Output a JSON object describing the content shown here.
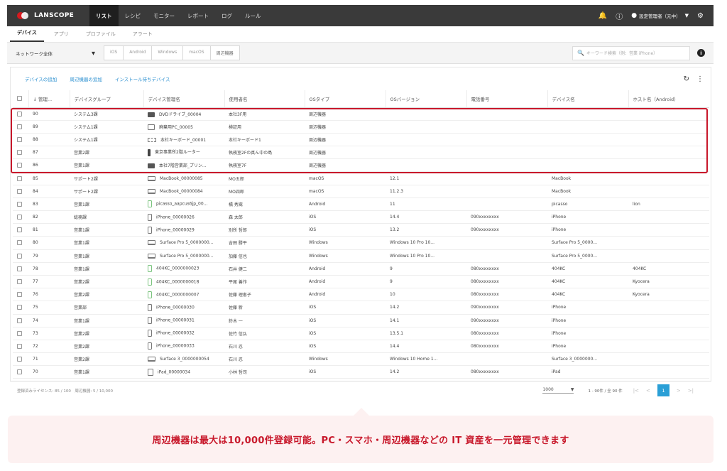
{
  "app": {
    "logo": "LANSCOPE"
  },
  "nav": [
    "リスト",
    "レシピ",
    "モニター",
    "レポート",
    "ログ",
    "ルール"
  ],
  "header": {
    "user": "設定管理者（元中）"
  },
  "subtabs": [
    "デバイス",
    "アプリ",
    "プロファイル",
    "アラート"
  ],
  "filters": {
    "scope": "ネットワーク全体",
    "os_tabs": [
      "iOS",
      "Android",
      "Windows",
      "macOS",
      "周辺機器"
    ],
    "search_placeholder": "キーワード検索（例：営業 iPhone）"
  },
  "actions": [
    "デバイスの追加",
    "周辺機器の追加",
    "インストール待ちデバイス"
  ],
  "columns": [
    "管理...",
    "デバイスグループ",
    "デバイス管理名",
    "使用者名",
    "OSタイプ",
    "OSバージョン",
    "電話番号",
    "デバイス名",
    "ホスト名（Android）"
  ],
  "rows": [
    {
      "id": "90",
      "group": "システム3課",
      "icon": "printer",
      "name": "DVDドライブ_00004",
      "user": "本社3F用",
      "os": "周辺機器",
      "ver": "",
      "phone": "",
      "device": "",
      "host": ""
    },
    {
      "id": "89",
      "group": "システム1課",
      "icon": "pc",
      "name": "廃棄用PC_00005",
      "user": "検証用",
      "os": "周辺機器",
      "ver": "",
      "phone": "",
      "device": "",
      "host": ""
    },
    {
      "id": "88",
      "group": "システム1課",
      "icon": "keyboard",
      "name": "本社キーボード_00001",
      "user": "本社キーボード1",
      "os": "周辺機器",
      "ver": "",
      "phone": "",
      "device": "",
      "host": ""
    },
    {
      "id": "87",
      "group": "営業2課",
      "icon": "router",
      "name": "東京事業所2階ルーター",
      "user": "執務室2Fの真ん中の島",
      "os": "周辺機器",
      "ver": "",
      "phone": "",
      "device": "",
      "host": ""
    },
    {
      "id": "86",
      "group": "営業1課",
      "icon": "printer",
      "name": "本社7階営業部_プリン...",
      "user": "執務室7F",
      "os": "周辺機器",
      "ver": "",
      "phone": "",
      "device": "",
      "host": ""
    },
    {
      "id": "85",
      "group": "サポート2課",
      "icon": "laptop",
      "name": "MacBook_00000085",
      "user": "MO五郎",
      "os": "macOS",
      "ver": "12.1",
      "phone": "",
      "device": "MacBook",
      "host": ""
    },
    {
      "id": "84",
      "group": "サポート2課",
      "icon": "laptop",
      "name": "MacBook_00000084",
      "user": "MO四郎",
      "os": "macOS",
      "ver": "11.2.3",
      "phone": "",
      "device": "MacBook",
      "host": ""
    },
    {
      "id": "83",
      "group": "営業1課",
      "icon": "android",
      "name": "picasso_aapcus6jp_00...",
      "user": "橘 秀嵩",
      "os": "Android",
      "ver": "11",
      "phone": "",
      "device": "picasso",
      "host": "lion"
    },
    {
      "id": "82",
      "group": "総務課",
      "icon": "phone",
      "name": "iPhone_00000026",
      "user": "森 太郎",
      "os": "iOS",
      "ver": "14.4",
      "phone": "090xxxxxxxx",
      "device": "iPhone",
      "host": ""
    },
    {
      "id": "81",
      "group": "営業1課",
      "icon": "phone",
      "name": "iPhone_00000029",
      "user": "別所 哲郎",
      "os": "iOS",
      "ver": "13.2",
      "phone": "090xxxxxxxx",
      "device": "iPhone",
      "host": ""
    },
    {
      "id": "80",
      "group": "営業1課",
      "icon": "laptop",
      "name": "Surface Pro 5_0000000...",
      "user": "吉田 勝平",
      "os": "Windows",
      "ver": "Windows 10 Pro 10...",
      "phone": "",
      "device": "Surface Pro 5_0000...",
      "host": ""
    },
    {
      "id": "79",
      "group": "営業1課",
      "icon": "laptop",
      "name": "Surface Pro 5_0000000...",
      "user": "加藤 信也",
      "os": "Windows",
      "ver": "Windows 10 Pro 10...",
      "phone": "",
      "device": "Surface Pro 5_0000...",
      "host": ""
    },
    {
      "id": "78",
      "group": "営業1課",
      "icon": "android",
      "name": "404KC_0000000023",
      "user": "石井 健二",
      "os": "Android",
      "ver": "9",
      "phone": "080xxxxxxxx",
      "device": "404KC",
      "host": "404KC"
    },
    {
      "id": "77",
      "group": "営業2課",
      "icon": "android",
      "name": "404KC_0000000018",
      "user": "平尾 善作",
      "os": "Android",
      "ver": "9",
      "phone": "080xxxxxxxx",
      "device": "404KC",
      "host": "Kyocera"
    },
    {
      "id": "76",
      "group": "営業2課",
      "icon": "android",
      "name": "404KC_0000000007",
      "user": "佐藤 理恵子",
      "os": "Android",
      "ver": "10",
      "phone": "080xxxxxxxx",
      "device": "404KC",
      "host": "Kyocera"
    },
    {
      "id": "75",
      "group": "営業部",
      "icon": "phone",
      "name": "iPhone_00000030",
      "user": "佐藤 新",
      "os": "iOS",
      "ver": "14.2",
      "phone": "090xxxxxxxx",
      "device": "iPhone",
      "host": ""
    },
    {
      "id": "74",
      "group": "営業1課",
      "icon": "phone",
      "name": "iPhone_00000031",
      "user": "鈴木 一",
      "os": "iOS",
      "ver": "14.1",
      "phone": "090xxxxxxxx",
      "device": "iPhone",
      "host": ""
    },
    {
      "id": "73",
      "group": "営業2課",
      "icon": "phone",
      "name": "iPhone_00000032",
      "user": "佐竹 信弘",
      "os": "iOS",
      "ver": "13.5.1",
      "phone": "080xxxxxxxx",
      "device": "iPhone",
      "host": ""
    },
    {
      "id": "72",
      "group": "営業2課",
      "icon": "phone",
      "name": "iPhone_00000033",
      "user": "石川 忍",
      "os": "iOS",
      "ver": "14.4",
      "phone": "080xxxxxxxx",
      "device": "iPhone",
      "host": ""
    },
    {
      "id": "71",
      "group": "営業2課",
      "icon": "laptop",
      "name": "Surface 3_0000000054",
      "user": "石川 忍",
      "os": "Windows",
      "ver": "Windows 10 Home 1...",
      "phone": "",
      "device": "Surface 3_0000000...",
      "host": ""
    },
    {
      "id": "70",
      "group": "営業1課",
      "icon": "tablet",
      "name": "iPad_00000034",
      "user": "小林 哲司",
      "os": "iOS",
      "ver": "14.2",
      "phone": "080xxxxxxxx",
      "device": "iPad",
      "host": ""
    }
  ],
  "footer": {
    "license": "登録済みライセンス: 85 / 100　周辺機器: 5 / 10,000",
    "per_page": "1000",
    "range": "1 - 90件 / 全 90 件",
    "current_page": "1"
  },
  "callout": "周辺機器は最大は10,000件登録可能。PC・スマホ・周辺機器などの IT 資産を一元管理できます",
  "colors": {
    "accent": "#2a9fd6",
    "highlight": "#c8182b",
    "topbar": "#3a3a3a"
  }
}
